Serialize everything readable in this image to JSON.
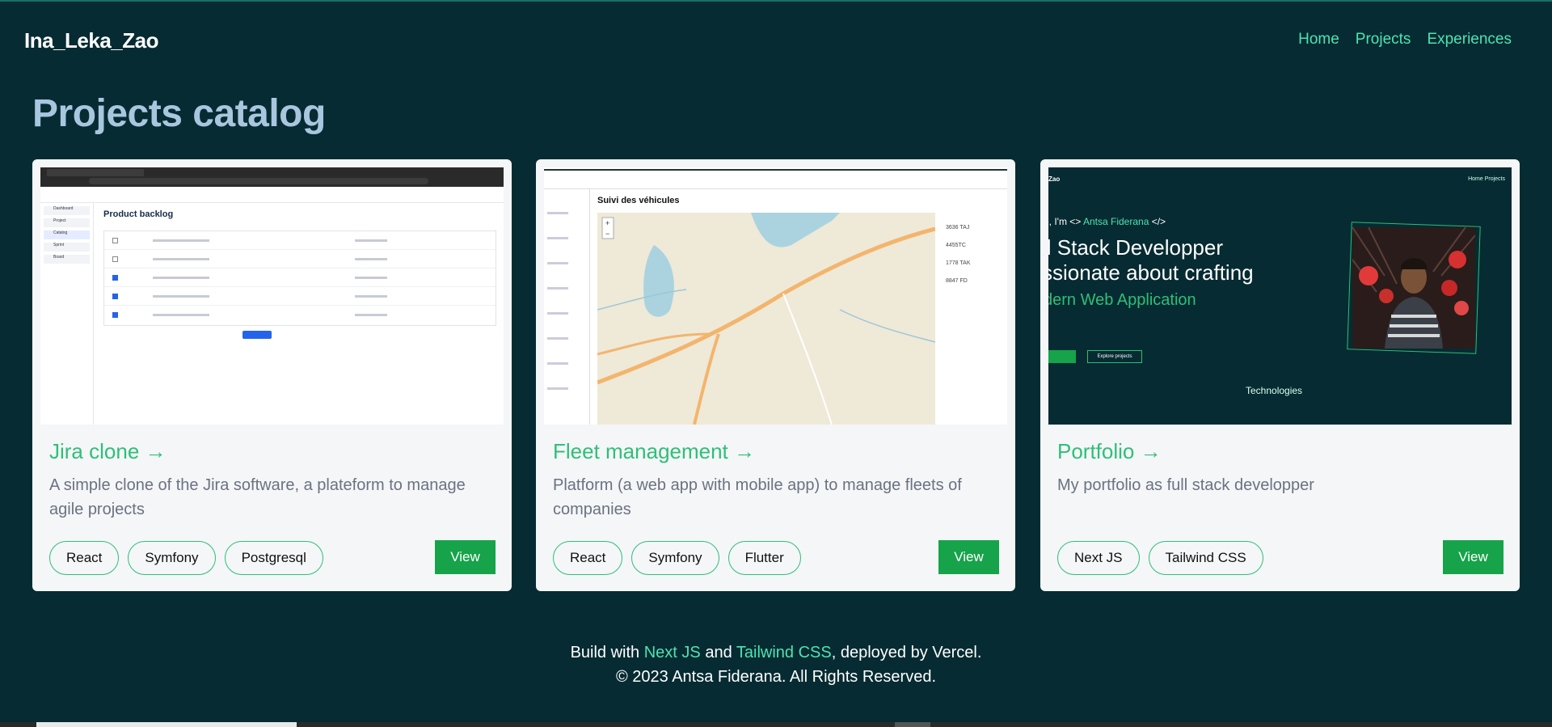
{
  "header": {
    "brand": "Ina_Leka_Zao",
    "nav": [
      "Home",
      "Projects",
      "Experiences"
    ]
  },
  "page_title": "Projects catalog",
  "projects": [
    {
      "title": "Jira clone →",
      "description": "A simple clone of the Jira software, a plateform to manage agile projects",
      "tags": [
        "React",
        "Symfony",
        "Postgresql"
      ],
      "view_label": "View",
      "screenshot": {
        "heading": "Product backlog",
        "sidebar": [
          "Dashboard",
          "Project",
          "Catalog",
          "Sprint",
          "Board"
        ]
      }
    },
    {
      "title": "Fleet management →",
      "description": "Platform (a web app with mobile app) to manage fleets of companies",
      "tags": [
        "React",
        "Symfony",
        "Flutter"
      ],
      "view_label": "View",
      "screenshot": {
        "heading": "Suivi des véhicules",
        "list": [
          "3636 TAJ",
          "4455TC",
          "1778 TAK",
          "8847 FD"
        ]
      }
    },
    {
      "title": "Portfolio →",
      "description": "My portfolio as full stack developper",
      "tags": [
        "Next JS",
        "Tailwind CSS"
      ],
      "view_label": "View",
      "screenshot": {
        "logo": "Zao",
        "nav": "Home   Projects",
        "greeting_prefix": "e, I'm <> ",
        "greeting_name": "Antsa Fiderana",
        "greeting_suffix": " </>",
        "headline_1": "ll Stack Developper",
        "headline_2": "ssionate about crafting",
        "headline_3": "dern Web Application",
        "explore": "Explore projects",
        "technologies": "Technologies"
      }
    }
  ],
  "footer": {
    "line1_prefix": "Build with ",
    "line1_link1": "Next JS",
    "line1_mid": " and ",
    "line1_link2": "Tailwind CSS",
    "line1_suffix": ", deployed by Vercel.",
    "line2": "© 2023 Antsa Fiderana. All Rights Reserved."
  },
  "colors": {
    "background": "#062b32",
    "accent": "#2fbf77",
    "nav_link": "#4ee3b1",
    "title": "#a9c6df",
    "button": "#16a34a"
  }
}
